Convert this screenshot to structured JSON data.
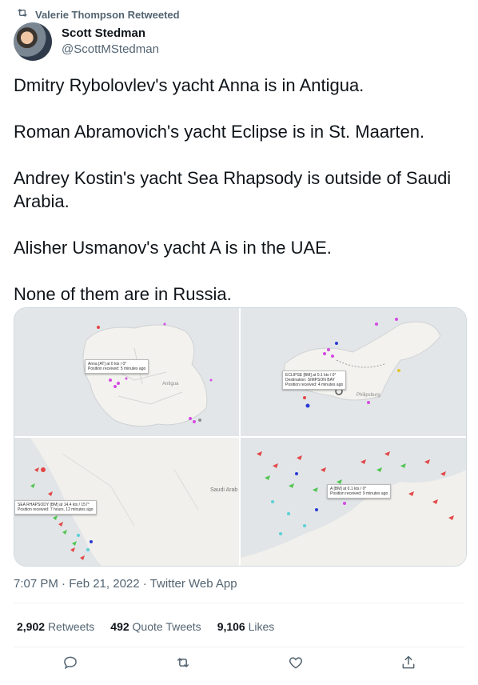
{
  "retweet": {
    "text": "Valerie Thompson Retweeted"
  },
  "author": {
    "name": "Scott Stedman",
    "handle": "@ScottMStedman"
  },
  "tweet": {
    "paragraphs": [
      "Dmitry Rybolovlev's yacht Anna is in Antigua.",
      "Roman Abramovich's yacht Eclipse is in St. Maarten.",
      "Andrey Kostin's yacht Sea Rhapsody is outside of Saudi Arabia.",
      "Alisher Usmanov's yacht A is in the UAE.",
      "None of them are in Russia."
    ]
  },
  "media": {
    "map1": {
      "popup_line1": "Anna [AT] at 0 kts / 0°",
      "popup_line2": "Position received: 5 minutes ago",
      "label": "Antigua"
    },
    "map2": {
      "popup_line1": "ECLIPSE [BM] at 0.1 kts / 0°",
      "popup_line2": "Destination: SIMPSON BAY",
      "popup_line3": "Position received: 4 minutes ago",
      "label": "Philipsburg"
    },
    "map3": {
      "popup_line1": "SEA RHAPSODY [BM] at 14.4 kts / 157°",
      "popup_line2": "Position received: 7 hours, 12 minutes ago",
      "label": "Saudi Arab"
    },
    "map4": {
      "popup_line1": "A [BM] at 0.1 kts / 0°",
      "popup_line2": "Position received: 9 minutes ago"
    }
  },
  "meta": {
    "timestamp": "7:07 PM · Feb 21, 2022 · Twitter Web App"
  },
  "stats": {
    "retweets_count": "2,902",
    "retweets_label": "Retweets",
    "quotes_count": "492",
    "quotes_label": "Quote Tweets",
    "likes_count": "9,106",
    "likes_label": "Likes"
  },
  "icons": [
    "retweet-icon",
    "reply-icon",
    "retweet-action-icon",
    "like-icon",
    "share-icon"
  ],
  "colors": {
    "secondary_text": "#536471",
    "primary_text": "#0f1419"
  }
}
